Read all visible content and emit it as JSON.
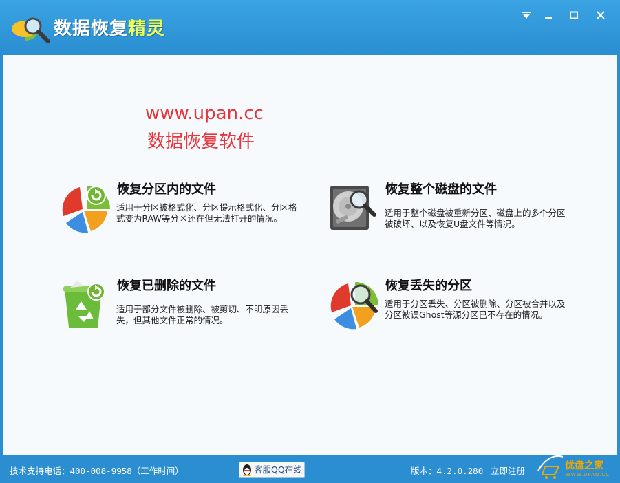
{
  "app": {
    "title_main": "数据恢复",
    "title_highlight": "精灵"
  },
  "window_controls": {
    "menu_icon": "menu-dropdown-icon",
    "minimize": "—",
    "maximize": "□",
    "close": "✕"
  },
  "promo": {
    "line1": "www.upan.cc",
    "line2": "数据恢复软件"
  },
  "cards": [
    {
      "title": "恢复分区内的文件",
      "desc": "适用于分区被格式化、分区提示格式化、分区格式变为RAW等分区还在但无法打开的情况。",
      "icon": "pie-refresh-icon"
    },
    {
      "title": "恢复整个磁盘的文件",
      "desc": "适用于整个磁盘被重新分区、磁盘上的多个分区被破坏、以及恢复U盘文件等情况。",
      "icon": "hard-disk-magnifier-icon"
    },
    {
      "title": "恢复已删除的文件",
      "desc": "适用于部分文件被删除、被剪切、不明原因丢失，但其他文件正常的情况。",
      "icon": "recycle-bin-icon"
    },
    {
      "title": "恢复丢失的分区",
      "desc": "适用于分区丢失、分区被删除、分区被合并以及分区被误Ghost等源分区已不存在的情况。",
      "icon": "pie-magnifier-icon"
    }
  ],
  "status": {
    "phone": "技术支持电话：400-008-9958（工作时间）",
    "qq_button": "客服QQ在线",
    "version": "版本：4.2.0.280",
    "register": "立即注册",
    "watermark_title": "优盘之家",
    "watermark_url": "WWW.UPAN.CC"
  },
  "colors": {
    "titlebar": "#2b8ed1",
    "promo_text": "#e8343a",
    "content_bg": "#f6fafd"
  }
}
